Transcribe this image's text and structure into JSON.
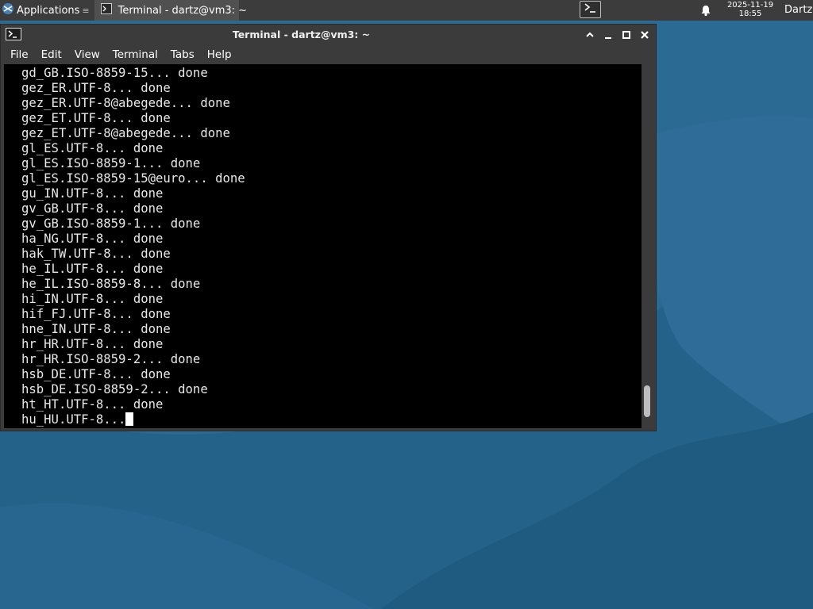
{
  "panel": {
    "applications_label": "Applications",
    "applications_separator": "≡",
    "taskbar_item_label": "Terminal - dartz@vm3: ~",
    "clock_date": "2025-11-19",
    "clock_time": "18:55",
    "user_label": "Dartz"
  },
  "window": {
    "title": "Terminal - dartz@vm3: ~",
    "menu": [
      "File",
      "Edit",
      "View",
      "Terminal",
      "Tabs",
      "Help"
    ]
  },
  "terminal": {
    "lines": [
      "gd_GB.ISO-8859-15... done",
      "gez_ER.UTF-8... done",
      "gez_ER.UTF-8@abegede... done",
      "gez_ET.UTF-8... done",
      "gez_ET.UTF-8@abegede... done",
      "gl_ES.UTF-8... done",
      "gl_ES.ISO-8859-1... done",
      "gl_ES.ISO-8859-15@euro... done",
      "gu_IN.UTF-8... done",
      "gv_GB.UTF-8... done",
      "gv_GB.ISO-8859-1... done",
      "ha_NG.UTF-8... done",
      "hak_TW.UTF-8... done",
      "he_IL.UTF-8... done",
      "he_IL.ISO-8859-8... done",
      "hi_IN.UTF-8... done",
      "hif_FJ.UTF-8... done",
      "hne_IN.UTF-8... done",
      "hr_HR.UTF-8... done",
      "hr_HR.ISO-8859-2... done",
      "hsb_DE.UTF-8... done",
      "hsb_DE.ISO-8859-2... done",
      "ht_HT.UTF-8... done"
    ],
    "current_line": "hu_HU.UTF-8...",
    "scroll_position": 0.97
  },
  "colors": {
    "panel_bg": "#3c3c3c",
    "window_bg": "#3b3b3b",
    "terminal_bg": "#000000",
    "terminal_fg": "#e8e8e8",
    "wallpaper": "#2b6a93"
  },
  "icons": {
    "applications": "xfce-logo-icon",
    "taskbar": "terminal-icon",
    "launcher": "terminal-prompt-icon",
    "notifications": "bell-icon",
    "window": "terminal-icon",
    "shade": "chevron-up-icon",
    "minimize": "minimize-icon",
    "maximize": "maximize-icon",
    "close": "close-icon"
  }
}
